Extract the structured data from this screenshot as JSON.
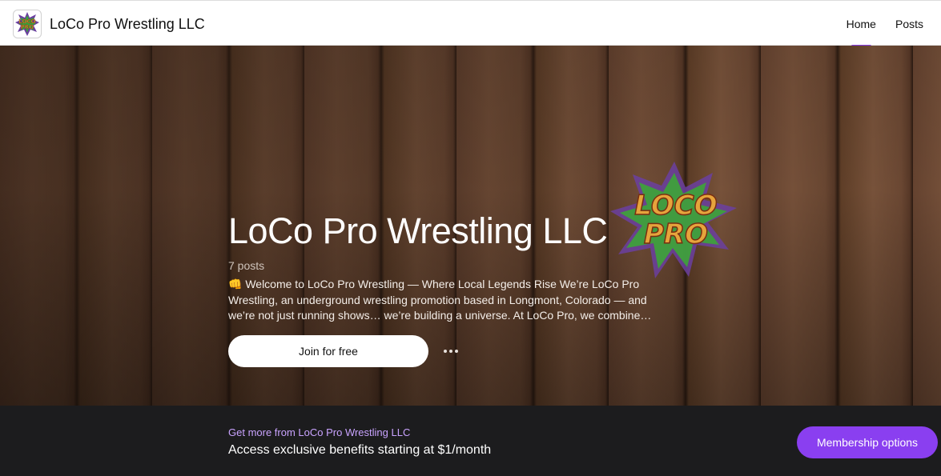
{
  "header": {
    "brand_name": "LoCo Pro Wrestling LLC",
    "logo_text": [
      "LOCO",
      "PRO"
    ],
    "nav": [
      {
        "label": "Home",
        "active": true
      },
      {
        "label": "Posts",
        "active": false
      }
    ]
  },
  "hero": {
    "title": "LoCo Pro Wrestling LLC",
    "post_count": "7 posts",
    "description": "👊 Welcome to LoCo Pro Wrestling — Where Local Legends Rise We’re LoCo Pro Wrestling, an underground wrestling promotion based in Longmont, Colorado — and we’re not just running shows… we’re building a universe. At LoCo Pro, we combine…",
    "join_label": "Join for free",
    "badge_text": [
      "LOCO",
      "PRO"
    ]
  },
  "membership": {
    "kicker": "Get more from LoCo Pro Wrestling LLC",
    "text": "Access exclusive benefits starting at $1/month",
    "button_label": "Membership options"
  },
  "colors": {
    "accent": "#8a3ff0",
    "accent_text": "#c9a3ff",
    "dark_bar": "#1c1c1e",
    "logo_green": "#2f8f2a",
    "logo_purple": "#6b3fa0",
    "logo_orange": "#e3a13a"
  }
}
